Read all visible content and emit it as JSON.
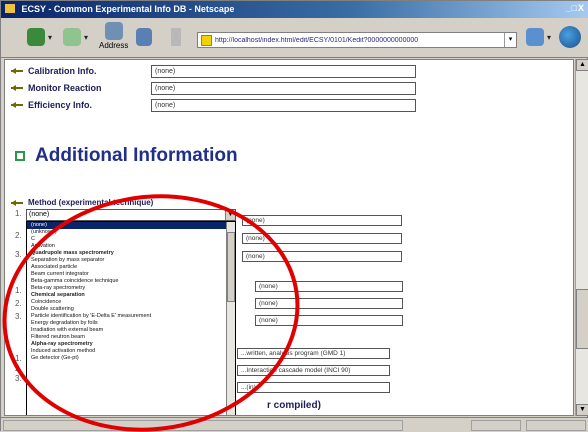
{
  "window": {
    "title": "ECSY - Common Experimental Info DB - Netscape",
    "controls": "_□X"
  },
  "toolbar": {
    "address_label": "Address",
    "url": "http://localhost/index.html/edit/ECSY/0101/Kedit?0000000000000"
  },
  "info_rows": [
    {
      "label": "Calibration Info.",
      "value": "(none)"
    },
    {
      "label": "Monitor Reaction",
      "value": "(none)"
    },
    {
      "label": "Efficiency Info.",
      "value": "(none)"
    }
  ],
  "section": {
    "title": "Additional Information"
  },
  "method": {
    "label": "Method (experimental technique)",
    "selected": "(none)",
    "options": [
      {
        "text": "(none)",
        "kind": "selected"
      },
      {
        "text": "(unknown)",
        "kind": "normal"
      },
      {
        "text": "C",
        "kind": "normal"
      },
      {
        "text": "Activation",
        "kind": "normal"
      },
      {
        "text": "Quadrupole mass spectrometry",
        "kind": "header"
      },
      {
        "text": "Separation by mass separator",
        "kind": "normal"
      },
      {
        "text": "Associated particle",
        "kind": "normal"
      },
      {
        "text": "Beam current integrator",
        "kind": "normal"
      },
      {
        "text": "Beta-gamma coincidence technique",
        "kind": "normal"
      },
      {
        "text": "Beta-ray spectrometry",
        "kind": "normal"
      },
      {
        "text": "Chemical separation",
        "kind": "header"
      },
      {
        "text": "Coincidence",
        "kind": "normal"
      },
      {
        "text": "Double scattering",
        "kind": "normal"
      },
      {
        "text": "Particle identification by 'E-Delta E' measurement",
        "kind": "normal"
      },
      {
        "text": "Energy degradation by foils",
        "kind": "normal"
      },
      {
        "text": "Irradiation with external beam",
        "kind": "normal"
      },
      {
        "text": "Filtered neutron beam",
        "kind": "normal"
      },
      {
        "text": "Alpha-ray spectrometry",
        "kind": "header"
      },
      {
        "text": "Induced activation method",
        "kind": "normal"
      },
      {
        "text": "Ge detector (Ge-pt)",
        "kind": "normal"
      }
    ]
  },
  "row_numbers": [
    "1.",
    "2.",
    "3.",
    "1.",
    "2.",
    "3.",
    "1.",
    "2.",
    "3."
  ],
  "right_selects_a": [
    "(none)",
    "(none)",
    "(none)"
  ],
  "right_selects_b": [
    "(none)",
    "(none)",
    "(none)"
  ],
  "right_selects_wide": [
    "...written, analysis program (GMD 1)",
    "...Interaction cascade model (INCI 90)",
    "...(in)"
  ],
  "data_compiled": "r compiled)",
  "status": {
    "main": "",
    "zone": "",
    "icons": ""
  }
}
